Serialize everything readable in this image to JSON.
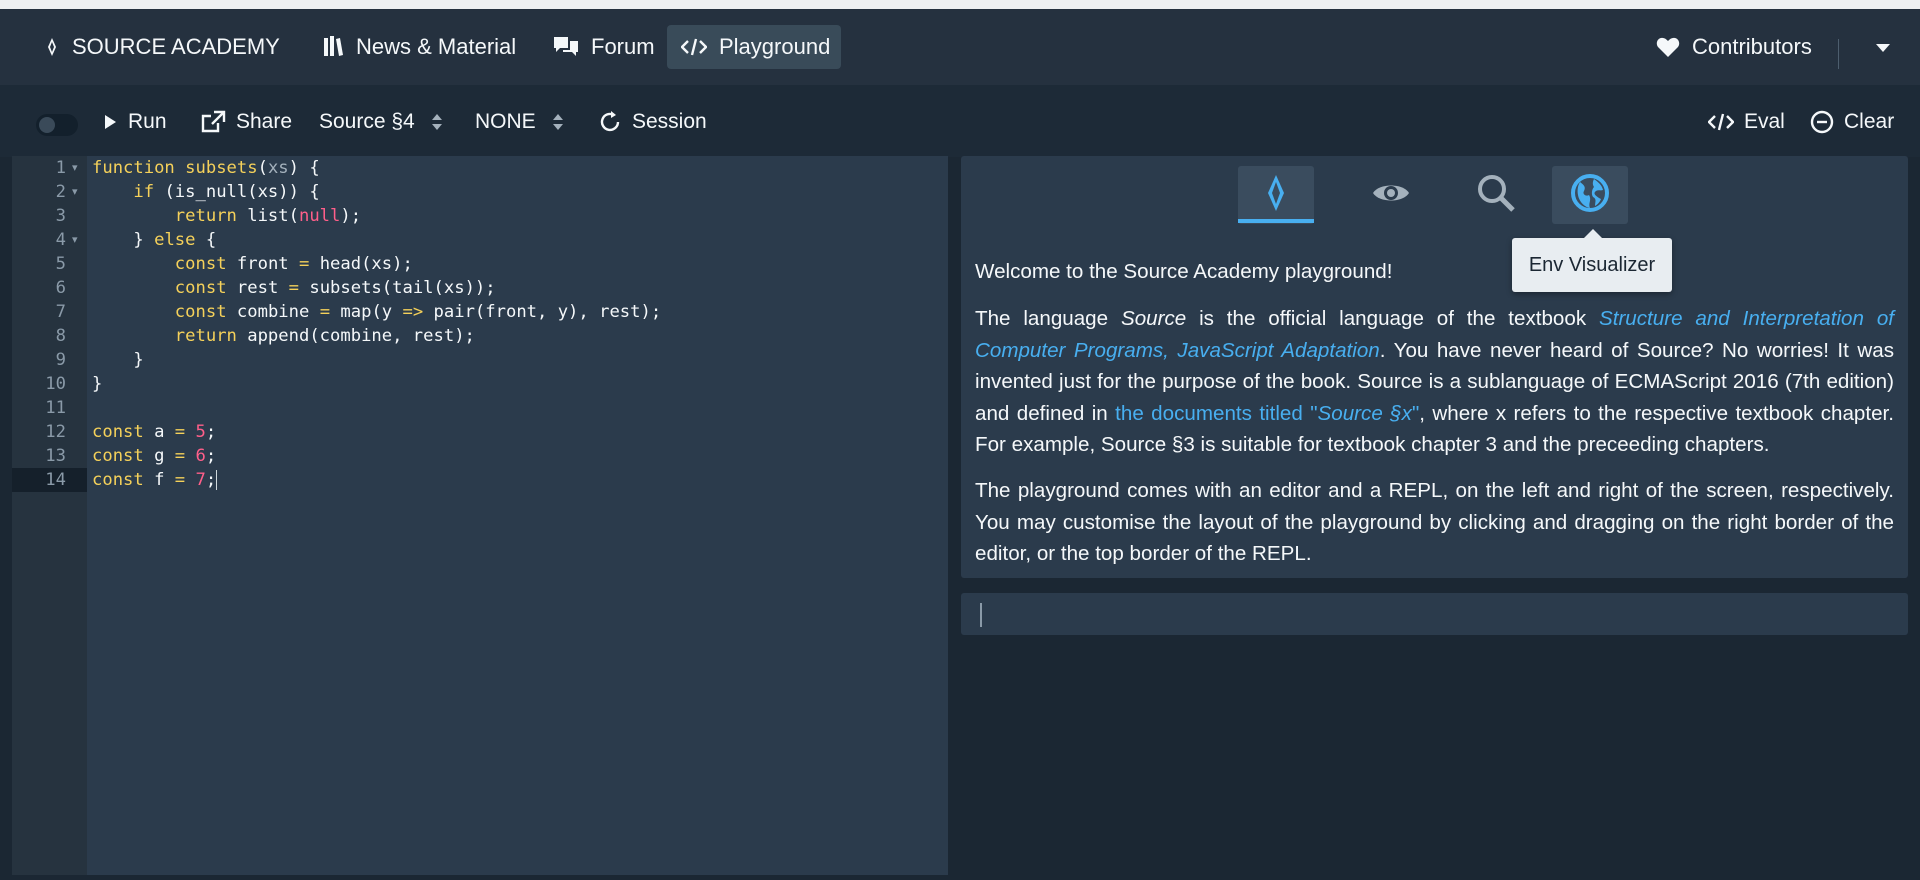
{
  "navbar": {
    "brand": "SOURCE ACADEMY",
    "news": "News & Material",
    "forum": "Forum",
    "playground": "Playground",
    "contributors": "Contributors"
  },
  "toolbar": {
    "run": "Run",
    "share": "Share",
    "chapter": "Source §4",
    "variant": "NONE",
    "session": "Session",
    "eval": "Eval",
    "clear": "Clear"
  },
  "editor": {
    "line_numbers": [
      "1",
      "2",
      "3",
      "4",
      "5",
      "6",
      "7",
      "8",
      "9",
      "10",
      "11",
      "12",
      "13",
      "14"
    ],
    "active_line": 14
  },
  "side_panel": {
    "tooltip": "Env Visualizer",
    "tabs": [
      "introduction",
      "substitution-visualizer",
      "inspector",
      "env-visualizer"
    ],
    "welcome": "Welcome to the Source Academy playground!",
    "p1_a": "The language ",
    "p1_b": "Source",
    "p1_c": " is the official language of the textbook ",
    "p1_link": "Structure and Interpretation of Computer Programs, JavaScript Adaptation",
    "p1_d": ". You have never heard of Source? No worries! It was invented just for the purpose of the book. Source is a sublanguage of ECMAScript 2016 (7th edition) and defined in ",
    "p1_link2a": "the documents titled \"",
    "p1_link2b": "Source §x",
    "p1_link2c": "\"",
    "p1_e": ", where x refers to the respective textbook chapter. For example, Source §3 is suitable for textbook chapter 3 and the preceeding chapters.",
    "p2": "The playground comes with an editor and a REPL, on the left and right of the screen, respectively. You may customise the layout of the playground by clicking and dragging on the right border of the editor, or the top border of the REPL."
  },
  "colors": {
    "background": "#1b2733",
    "navbar": "#25313f",
    "panel": "#2b3b4c",
    "accent_blue": "#48aff0",
    "keyword_yellow": "#f5d15a",
    "number_pink": "#ff5f8a"
  }
}
